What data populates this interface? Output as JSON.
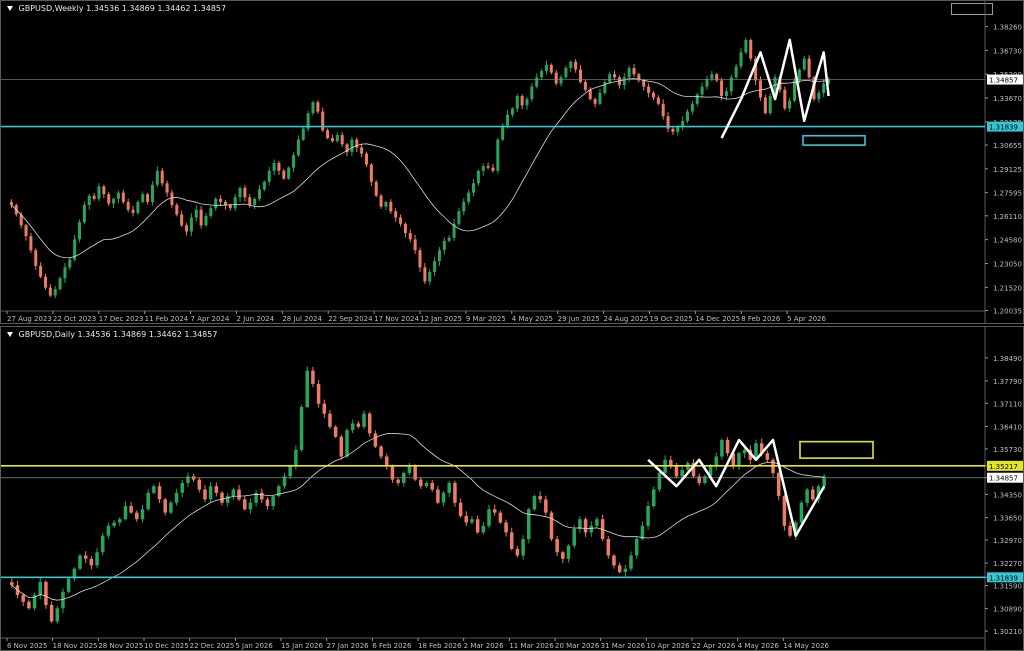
{
  "weekly": {
    "symbol_title": "GBPUSD,Weekly",
    "ohlc": "1.34536 1.34869 1.34462 1.34857",
    "chart_data": {
      "type": "candlestick",
      "ylim": [
        1.2,
        1.39
      ],
      "y_ticks": [
        "1.38260",
        "1.36730",
        "1.35200",
        "1.33670",
        "1.32139",
        "1.30655",
        "1.29125",
        "1.27595",
        "1.26110",
        "1.24580",
        "1.23050",
        "1.21520",
        "1.20035"
      ],
      "x_labels": [
        "27 Aug 2023",
        "22 Oct 2023",
        "17 Dec 2023",
        "11 Feb 2024",
        "7 Apr 2024",
        "2 Jun 2024",
        "28 Jul 2024",
        "22 Sep 2024",
        "17 Nov 2024",
        "12 Jan 2025",
        "9 Mar 2025",
        "4 May 2025",
        "29 Jun 2025",
        "24 Aug 2025",
        "19 Oct 2025",
        "14 Dec 2025",
        "8 Feb 2026",
        "5 Apr 2026"
      ],
      "current_price": "1.34857",
      "support_level": "1.31839",
      "close_series": [
        1.268,
        1.262,
        1.255,
        1.248,
        1.239,
        1.229,
        1.222,
        1.215,
        1.21,
        1.214,
        1.221,
        1.228,
        1.233,
        1.246,
        1.257,
        1.268,
        1.274,
        1.272,
        1.28,
        1.275,
        1.269,
        1.272,
        1.276,
        1.27,
        1.265,
        1.263,
        1.27,
        1.275,
        1.27,
        1.281,
        1.29,
        1.282,
        1.276,
        1.268,
        1.262,
        1.255,
        1.251,
        1.26,
        1.265,
        1.255,
        1.261,
        1.266,
        1.272,
        1.27,
        1.268,
        1.266,
        1.273,
        1.279,
        1.273,
        1.268,
        1.272,
        1.278,
        1.283,
        1.29,
        1.295,
        1.29,
        1.285,
        1.292,
        1.3,
        1.31,
        1.317,
        1.327,
        1.334,
        1.328,
        1.316,
        1.311,
        1.309,
        1.313,
        1.307,
        1.302,
        1.31,
        1.305,
        1.301,
        1.294,
        1.283,
        1.274,
        1.267,
        1.27,
        1.264,
        1.26,
        1.256,
        1.25,
        1.246,
        1.239,
        1.228,
        1.219,
        1.225,
        1.232,
        1.239,
        1.245,
        1.247,
        1.256,
        1.264,
        1.27,
        1.276,
        1.282,
        1.29,
        1.293,
        1.292,
        1.29,
        1.31,
        1.319,
        1.326,
        1.33,
        1.338,
        1.332,
        1.336,
        1.344,
        1.35,
        1.354,
        1.358,
        1.353,
        1.346,
        1.35,
        1.356,
        1.36,
        1.355,
        1.347,
        1.342,
        1.336,
        1.333,
        1.34,
        1.347,
        1.352,
        1.35,
        1.345,
        1.35,
        1.356,
        1.352,
        1.348,
        1.344,
        1.34,
        1.337,
        1.333,
        1.325,
        1.317,
        1.315,
        1.318,
        1.322,
        1.328,
        1.333,
        1.339,
        1.344,
        1.349,
        1.352,
        1.348,
        1.338,
        1.341,
        1.35,
        1.357,
        1.366,
        1.374,
        1.362,
        1.348,
        1.337,
        1.327,
        1.338,
        1.35,
        1.342,
        1.33,
        1.335,
        1.348,
        1.355,
        1.362,
        1.35,
        1.336,
        1.34,
        1.346,
        1.349
      ],
      "series": [
        {
          "name": "",
          "kind": "moving-average",
          "color": "#d9d9d9"
        }
      ]
    }
  },
  "daily": {
    "symbol_title": "GBPUSD,Daily",
    "ohlc": "1.34536 1.34869 1.34462 1.34857",
    "chart_data": {
      "type": "candlestick",
      "ylim": [
        1.3,
        1.39
      ],
      "y_ticks": [
        "1.38490",
        "1.37790",
        "1.37110",
        "1.36410",
        "1.35730",
        "1.35217",
        "1.34857",
        "1.34350",
        "1.33650",
        "1.32970",
        "1.32270",
        "1.31839",
        "1.31590",
        "1.30890",
        "1.30210"
      ],
      "x_labels": [
        "6 Nov 2025",
        "18 Nov 2025",
        "28 Nov 2025",
        "10 Dec 2025",
        "22 Dec 2025",
        "5 Jan 2026",
        "15 Jan 2026",
        "27 Jan 2026",
        "6 Feb 2026",
        "18 Feb 2026",
        "2 Mar 2026",
        "11 Mar 2026",
        "20 Mar 2026",
        "31 Mar 2026",
        "10 Apr 2026",
        "22 Apr 2026",
        "4 May 2026",
        "14 May 2026"
      ],
      "current_price": "1.34857",
      "resistance_level": "1.35217",
      "support_level": "1.31839",
      "close_series": [
        1.316,
        1.313,
        1.311,
        1.309,
        1.313,
        1.317,
        1.31,
        1.305,
        1.309,
        1.314,
        1.318,
        1.321,
        1.325,
        1.324,
        1.322,
        1.326,
        1.331,
        1.334,
        1.335,
        1.336,
        1.34,
        1.338,
        1.336,
        1.339,
        1.344,
        1.346,
        1.342,
        1.338,
        1.341,
        1.344,
        1.347,
        1.349,
        1.348,
        1.345,
        1.342,
        1.346,
        1.344,
        1.341,
        1.343,
        1.345,
        1.342,
        1.339,
        1.341,
        1.344,
        1.342,
        1.34,
        1.343,
        1.346,
        1.349,
        1.352,
        1.357,
        1.37,
        1.381,
        1.377,
        1.371,
        1.368,
        1.364,
        1.361,
        1.355,
        1.363,
        1.365,
        1.364,
        1.368,
        1.362,
        1.358,
        1.355,
        1.352,
        1.348,
        1.347,
        1.35,
        1.352,
        1.348,
        1.346,
        1.347,
        1.345,
        1.341,
        1.344,
        1.347,
        1.341,
        1.337,
        1.335,
        1.336,
        1.332,
        1.334,
        1.339,
        1.338,
        1.335,
        1.332,
        1.327,
        1.325,
        1.33,
        1.339,
        1.343,
        1.342,
        1.338,
        1.33,
        1.326,
        1.324,
        1.328,
        1.333,
        1.336,
        1.332,
        1.334,
        1.336,
        1.33,
        1.325,
        1.322,
        1.32,
        1.321,
        1.325,
        1.33,
        1.334,
        1.34,
        1.345,
        1.35,
        1.354,
        1.352,
        1.349,
        1.351,
        1.353,
        1.349,
        1.347,
        1.349,
        1.352,
        1.355,
        1.36,
        1.356,
        1.352,
        1.356,
        1.357,
        1.354,
        1.359,
        1.356,
        1.354,
        1.35,
        1.343,
        1.334,
        1.331,
        1.335,
        1.341,
        1.345,
        1.342,
        1.346,
        1.349
      ],
      "series": [
        {
          "name": "",
          "kind": "moving-average",
          "color": "#d9d9d9"
        }
      ]
    }
  },
  "colors": {
    "bull": "#26a65b",
    "bear": "#ef7b63",
    "background": "#000000",
    "grid_text": "#bfbfbf",
    "support": "#35c6d6",
    "resistance": "#e6e61f",
    "pattern": "#ffffff"
  }
}
